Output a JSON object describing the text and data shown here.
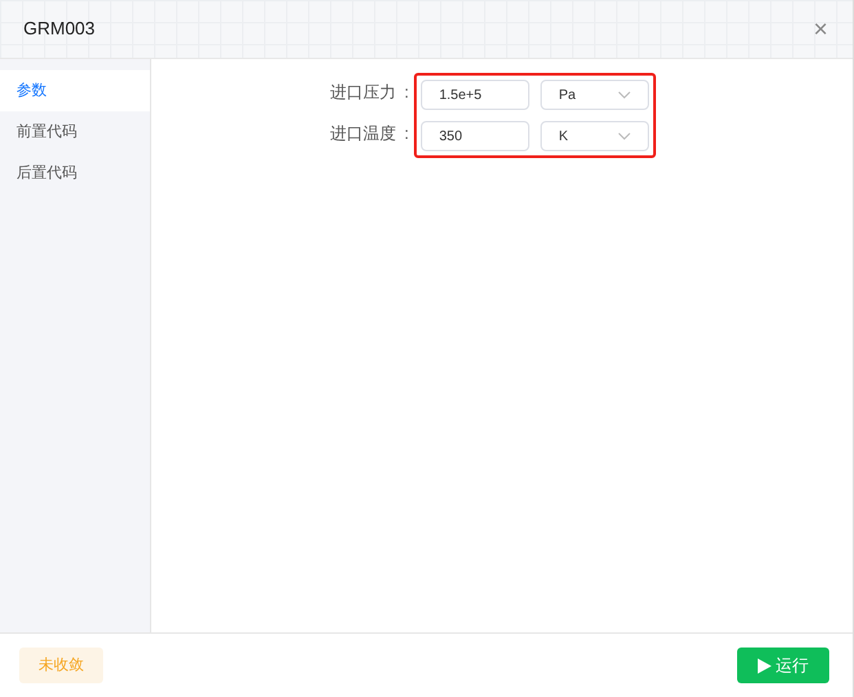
{
  "dialog": {
    "title": "GRM003",
    "close": "×"
  },
  "sidebar": {
    "items": [
      {
        "label": "参数",
        "selected": true
      },
      {
        "label": "前置代码",
        "selected": false
      },
      {
        "label": "后置代码",
        "selected": false
      }
    ]
  },
  "params": {
    "highlighted": true,
    "fields": [
      {
        "label": "进口压力",
        "separator": ":",
        "value": "1.5e+5",
        "unit": "Pa"
      },
      {
        "label": "进口温度",
        "separator": ":",
        "value": "350",
        "unit": "K"
      }
    ]
  },
  "footer": {
    "status": "未收敛",
    "run_button": "运行"
  }
}
